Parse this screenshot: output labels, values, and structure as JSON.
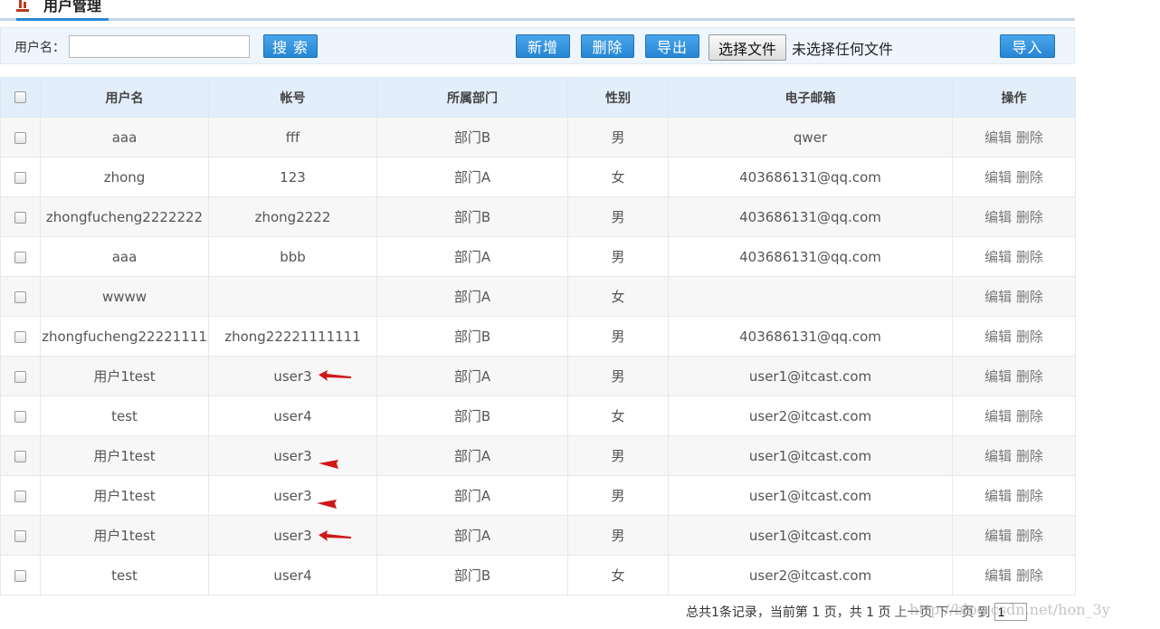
{
  "header": {
    "title": "用户管理",
    "icon": "bar-chart-icon"
  },
  "toolbar": {
    "username_label": "用户名：",
    "search_value": "",
    "search_button": "搜 索",
    "add_button": "新增",
    "delete_button": "删除",
    "export_button": "导出",
    "choose_file_button": "选择文件",
    "file_status": "未选择任何文件",
    "import_button": "导入"
  },
  "table": {
    "columns": [
      "用户名",
      "帐号",
      "所属部门",
      "性别",
      "电子邮箱",
      "操作"
    ],
    "edit_label": "编辑",
    "delete_label": "删除",
    "rows": [
      {
        "name": "aaa",
        "account": "fff",
        "dept": "部门B",
        "gender": "男",
        "email": "qwer"
      },
      {
        "name": "zhong",
        "account": "123",
        "dept": "部门A",
        "gender": "女",
        "email": "403686131@qq.com"
      },
      {
        "name": "zhongfucheng2222222",
        "account": "zhong2222",
        "dept": "部门B",
        "gender": "男",
        "email": "403686131@qq.com"
      },
      {
        "name": "aaa",
        "account": "bbb",
        "dept": "部门A",
        "gender": "男",
        "email": "403686131@qq.com"
      },
      {
        "name": "wwww",
        "account": "",
        "dept": "部门A",
        "gender": "女",
        "email": ""
      },
      {
        "name": "zhongfucheng22221111",
        "account": "zhong22221111111",
        "dept": "部门B",
        "gender": "男",
        "email": "403686131@qq.com"
      },
      {
        "name": "用户1test",
        "account": "user3",
        "dept": "部门A",
        "gender": "男",
        "email": "user1@itcast.com"
      },
      {
        "name": "test",
        "account": "user4",
        "dept": "部门B",
        "gender": "女",
        "email": "user2@itcast.com"
      },
      {
        "name": "用户1test",
        "account": "user3",
        "dept": "部门A",
        "gender": "男",
        "email": "user1@itcast.com"
      },
      {
        "name": "用户1test",
        "account": "user3",
        "dept": "部门A",
        "gender": "男",
        "email": "user1@itcast.com"
      },
      {
        "name": "用户1test",
        "account": "user3",
        "dept": "部门A",
        "gender": "男",
        "email": "user1@itcast.com"
      },
      {
        "name": "test",
        "account": "user4",
        "dept": "部门B",
        "gender": "女",
        "email": "user2@itcast.com"
      }
    ]
  },
  "pager": {
    "summary": "总共1条记录，当前第 1 页，共 1 页",
    "prev": "上一页",
    "next": "下一页",
    "goto": "到",
    "page_value": "1"
  },
  "watermark": "http://blog.csdn.net/hon_3y",
  "colors": {
    "accent": "#2b87d1",
    "arrow": "#d01818",
    "header_bg": "#e2eefa"
  }
}
